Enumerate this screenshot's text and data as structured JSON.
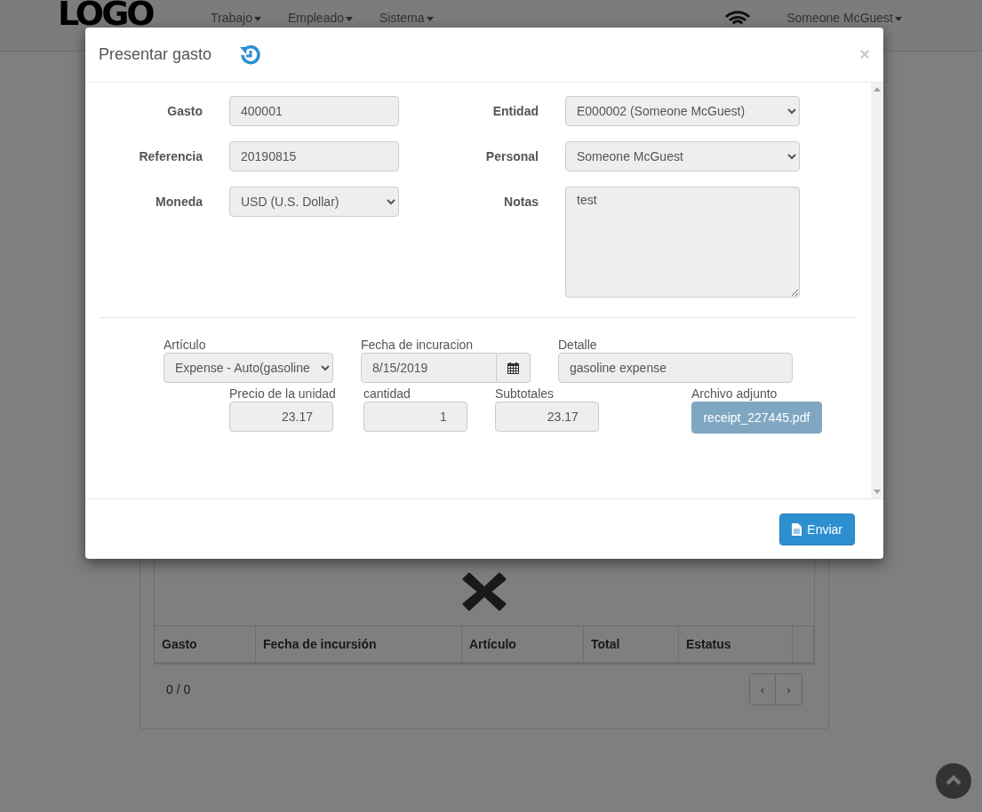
{
  "navbar": {
    "logo": "LOGO",
    "menus": [
      {
        "label": "Trabajo"
      },
      {
        "label": "Empleado"
      },
      {
        "label": "Sistema"
      }
    ],
    "user": "Someone McGuest"
  },
  "background": {
    "table": {
      "columns": [
        "Gasto",
        "Fecha de incursión",
        "Artículo",
        "Total",
        "Estatus"
      ]
    },
    "pagination": {
      "count": "0 / 0",
      "prev": "‹",
      "next": "›"
    }
  },
  "modal": {
    "title": "Presentar gasto",
    "close": "×",
    "left_fields": [
      {
        "label": "Gasto",
        "kind": "text",
        "value": "400001"
      },
      {
        "label": "Referencia",
        "kind": "text",
        "value": "20190815"
      },
      {
        "label": "Moneda",
        "kind": "select",
        "value": "USD (U.S. Dollar)"
      }
    ],
    "right_fields": [
      {
        "label": "Entidad",
        "kind": "select",
        "value": "E000002 (Someone McGuest)"
      },
      {
        "label": "Personal",
        "kind": "select",
        "value": "Someone McGuest"
      },
      {
        "label": "Notas",
        "kind": "textarea",
        "value": "test"
      }
    ],
    "item_row": [
      {
        "label": "Artículo",
        "kind": "select",
        "value": "Expense - Auto(gasoline"
      },
      {
        "label": "Fecha de incuracion",
        "kind": "date",
        "value": "8/15/2019"
      },
      {
        "label": "Detalle",
        "kind": "text",
        "value": "gasoline expense"
      }
    ],
    "amount_row": [
      {
        "label": "Precio de la unidad",
        "kind": "number",
        "value": "23.17"
      },
      {
        "label": "cantidad",
        "kind": "number",
        "value": "1"
      },
      {
        "label": "Subtotales",
        "kind": "number",
        "value": "23.17"
      },
      {
        "label": "Archivo adjunto",
        "kind": "file",
        "value": "receipt_227445.pdf"
      }
    ],
    "submit": "Enviar"
  }
}
